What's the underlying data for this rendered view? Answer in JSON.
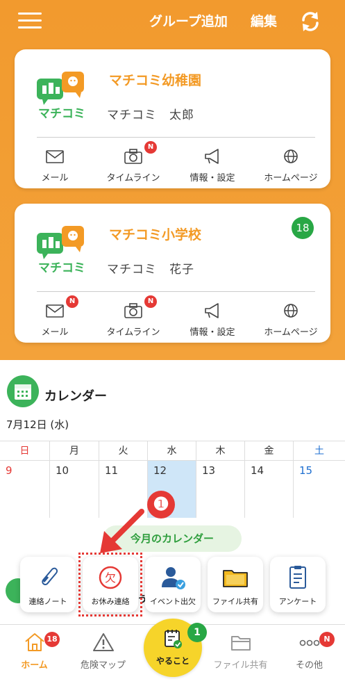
{
  "header": {
    "add_group": "グループ追加",
    "edit": "編集"
  },
  "groups": [
    {
      "school": "マチコミ幼稚園",
      "child": "マチコミ　太郎",
      "logo_text": "マチコミ",
      "badge": "",
      "actions": [
        {
          "label": "メール",
          "badge": ""
        },
        {
          "label": "タイムライン",
          "badge": "N"
        },
        {
          "label": "情報・設定",
          "badge": ""
        },
        {
          "label": "ホームページ",
          "badge": ""
        }
      ]
    },
    {
      "school": "マチコミ小学校",
      "child": "マチコミ　花子",
      "logo_text": "マチコミ",
      "badge": "18",
      "actions": [
        {
          "label": "メール",
          "badge": "N"
        },
        {
          "label": "タイムライン",
          "badge": "N"
        },
        {
          "label": "情報・設定",
          "badge": ""
        },
        {
          "label": "ホームページ",
          "badge": ""
        }
      ]
    }
  ],
  "calendar": {
    "title": "カレンダー",
    "date": "7月12日 (水)",
    "weekdays": [
      "日",
      "月",
      "火",
      "水",
      "木",
      "金",
      "土"
    ],
    "days": [
      "9",
      "10",
      "11",
      "12",
      "13",
      "14",
      "15"
    ],
    "month_button": "今月のカレンダー",
    "hidden_text": "う"
  },
  "annotation": {
    "step": "❶"
  },
  "quick_menu": [
    {
      "label": "連絡ノート"
    },
    {
      "label": "お休み連絡",
      "icon_text": "欠"
    },
    {
      "label": "イベント出欠"
    },
    {
      "label": "ファイル共有"
    },
    {
      "label": "アンケート"
    }
  ],
  "tabbar": {
    "home": {
      "label": "ホーム",
      "badge": "18"
    },
    "danger_map": {
      "label": "危険マップ"
    },
    "todo": {
      "label": "やること",
      "badge": "1"
    },
    "file_share": {
      "label": "ファイル共有"
    },
    "other": {
      "label": "その他",
      "badge": "N"
    }
  },
  "colors": {
    "brand_orange": "#f39a25",
    "green": "#3cb35a",
    "badge_red": "#e53935",
    "todo_yellow": "#f6d42a",
    "today_blue": "#cfe6f8"
  }
}
